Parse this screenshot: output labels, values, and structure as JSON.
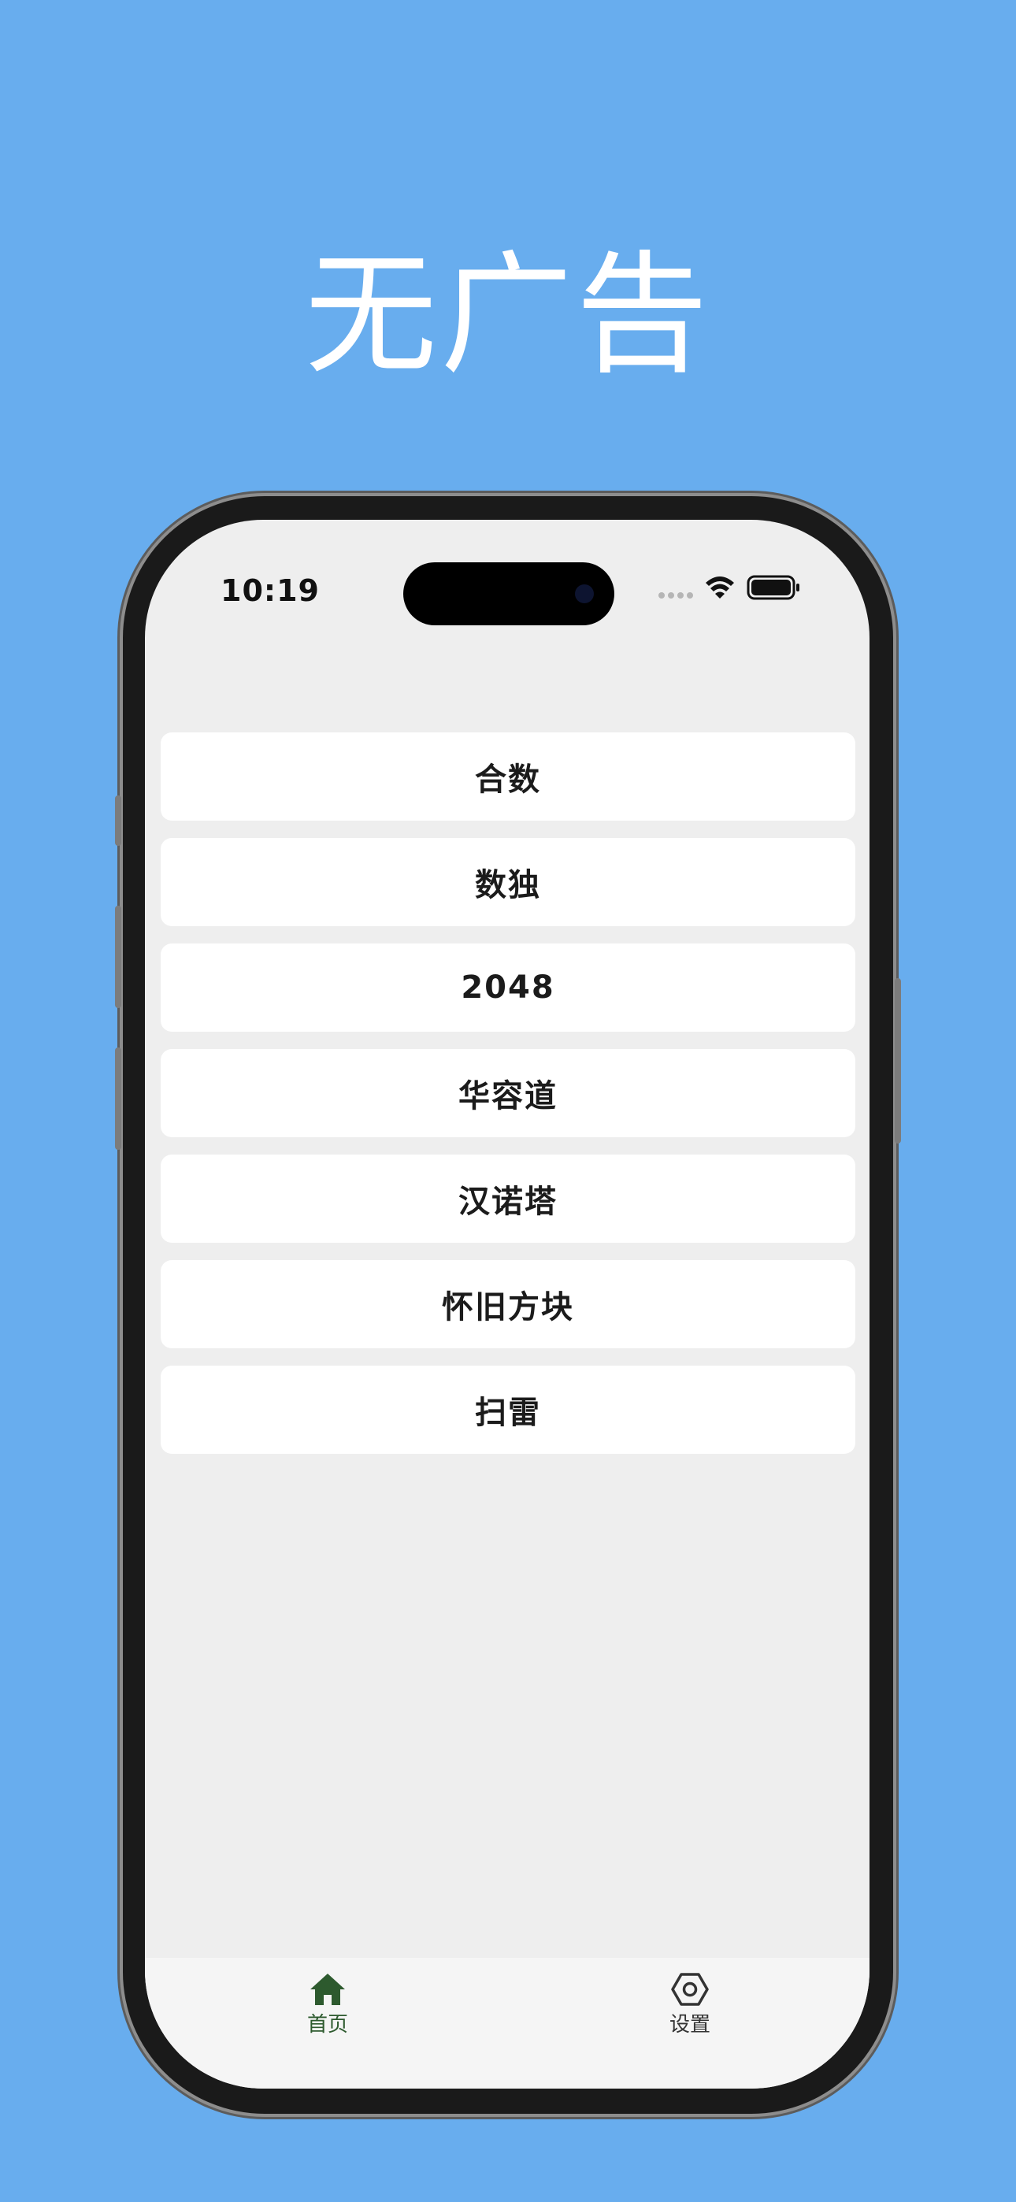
{
  "headline": "无广告",
  "status_bar": {
    "time": "10:19"
  },
  "menu": {
    "items": [
      {
        "label": "合数"
      },
      {
        "label": "数独"
      },
      {
        "label": "2048"
      },
      {
        "label": "华容道"
      },
      {
        "label": "汉诺塔"
      },
      {
        "label": "怀旧方块"
      },
      {
        "label": "扫雷"
      }
    ]
  },
  "tabbar": {
    "home": {
      "label": "首页",
      "icon": "home-icon",
      "active": true,
      "color": "#2d5a2e"
    },
    "settings": {
      "label": "设置",
      "icon": "settings-hex-icon",
      "active": false,
      "color": "#333333"
    }
  },
  "colors": {
    "background": "#68adee",
    "screen": "#eeeeee",
    "card": "#ffffff",
    "accent": "#2d5a2e"
  }
}
